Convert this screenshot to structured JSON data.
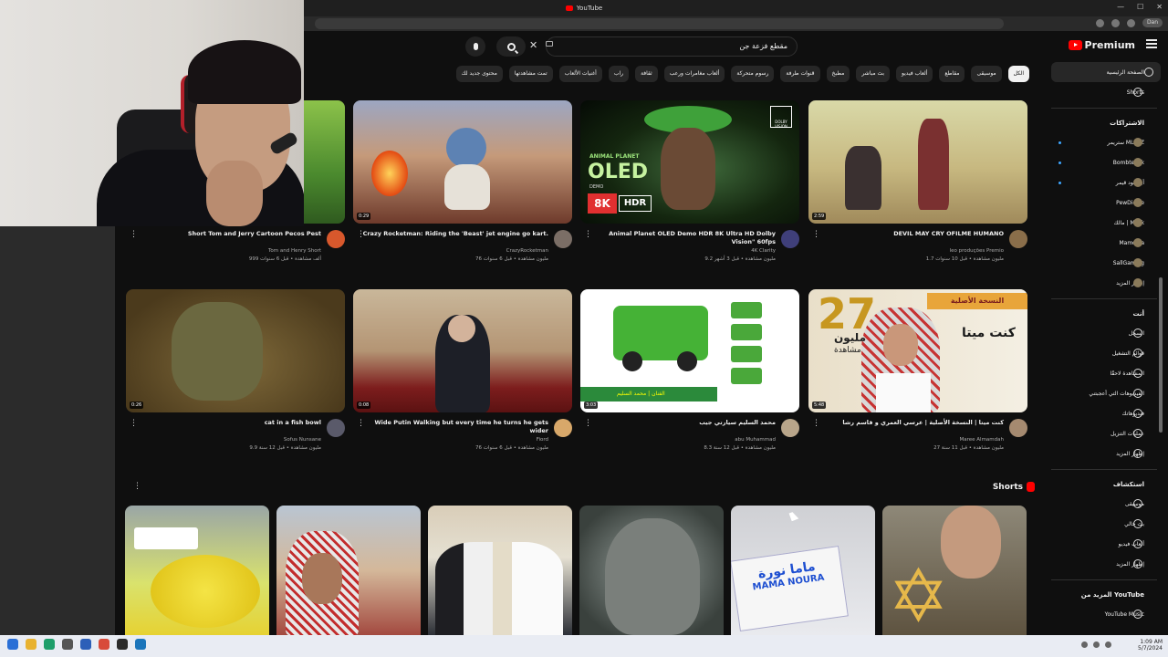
{
  "browser": {
    "tab_title": "YouTube",
    "user_chip": "Dan"
  },
  "masthead": {
    "logo_text": "Premium",
    "search_value": "مقطع فزعة جن",
    "icons": [
      "menu-icon",
      "search-icon",
      "mic-icon",
      "close-icon",
      "keyboard-icon"
    ]
  },
  "chips": [
    {
      "label": "الكل",
      "active": true
    },
    {
      "label": "موسيقى"
    },
    {
      "label": "مقاطع"
    },
    {
      "label": "ألعاب فيديو"
    },
    {
      "label": "بث مباشر"
    },
    {
      "label": "مطبخ"
    },
    {
      "label": "قنوات طرفة"
    },
    {
      "label": "رسوم متحركة"
    },
    {
      "label": "ألعاب مغامرات ورعب"
    },
    {
      "label": "ثقافة"
    },
    {
      "label": "راب"
    },
    {
      "label": "أغنيات الألعاب"
    },
    {
      "label": "تمت مشاهدتها"
    },
    {
      "label": "محتوى جديد لك"
    }
  ],
  "sidebar": {
    "main": [
      {
        "label": "الصفحة الرئيسية",
        "icon": "home-icon",
        "active": true
      },
      {
        "label": "Shorts",
        "icon": "shorts-icon"
      }
    ],
    "subscriptions_header": "الاشتراكات",
    "subscriptions": [
      {
        "label": "ستريمر MLZLZ",
        "live": true
      },
      {
        "label": "Bombtehkk",
        "live": true
      },
      {
        "label": "أبو جود قيمر",
        "live": true
      },
      {
        "label": "PewDiePie"
      },
      {
        "label": "مالك | Malik"
      },
      {
        "label": "Mamonia"
      },
      {
        "label": "SallGaming"
      },
      {
        "label": "إظهار المزيد"
      }
    ],
    "you_header": "أنت",
    "you": [
      {
        "label": "السجل",
        "icon": "history-icon"
      },
      {
        "label": "قوائم التشغيل",
        "icon": "playlist-icon"
      },
      {
        "label": "المشاهدة لاحقًا",
        "icon": "clock-icon"
      },
      {
        "label": "الفيديوهات التي أعجبتني",
        "icon": "thumbs-up-icon"
      },
      {
        "label": "فيديوهاتك",
        "icon": "video-icon"
      },
      {
        "label": "عمليات التنزيل",
        "icon": "download-icon"
      },
      {
        "label": "إظهار المزيد",
        "icon": "chevron-down-icon"
      }
    ],
    "explore_header": "استكشاف",
    "explore": [
      {
        "label": "موسيقى",
        "icon": "music-icon"
      },
      {
        "label": "بث حالي",
        "icon": "live-icon"
      },
      {
        "label": "ألعاب فيديو",
        "icon": "gaming-icon"
      },
      {
        "label": "إظهار المزيد",
        "icon": "chevron-down-icon"
      }
    ],
    "more_header": "المزيد من YouTube",
    "more": [
      {
        "label": "YouTube Music",
        "icon": "youtube-music-icon"
      }
    ]
  },
  "videos": [
    {
      "title": "DEVIL MAY CRY OFILME HUMANO",
      "channel": "leo produções Premio",
      "stats": "1.7 مليون مشاهدة • قبل 10 سنوات",
      "duration": "2:59",
      "avatar_color": "#8a6e4a",
      "thumb": "dmc"
    },
    {
      "title": "Animal Planet OLED Demo HDR 8K Ultra HD Dolby Vision\" 60fps",
      "channel": "4K Clarity",
      "stats": "9.2 مليون مشاهدة • قبل 3 أشهر",
      "duration": "",
      "avatar_color": "#3f3f7a",
      "thumb": "oled"
    },
    {
      "title": "Crazy Rocketman: Riding the 'Beast' jet engine go kart.",
      "channel": "CrazyRocketman",
      "stats": "76 مليون مشاهدة • قبل 6 سنوات",
      "duration": "0:29",
      "avatar_color": "#7b6e66",
      "thumb": "rocket"
    },
    {
      "title": "Short Tom and Jerry Cartoon Pecos Pest",
      "channel": "Tom and Henry Short",
      "stats": "999 ألف مشاهدة • قبل 6 سنوات",
      "duration": "",
      "avatar_color": "#d8582c",
      "thumb": "tom"
    },
    {
      "title": "كنت ميتا | النسخة الأصلية | عرسي العمري و قاسم رشا",
      "channel": "Maree Almamdah",
      "stats": "27 مليون مشاهدة • قبل 11 سنة",
      "duration": "5:48",
      "avatar_color": "#a58a70",
      "thumb": "saud"
    },
    {
      "title": "محمد السليم سيارتي جيب",
      "channel": "abu Muhammad",
      "stats": "8.3 مليون مشاهدة • قبل 12 سنة",
      "duration": "3:03",
      "avatar_color": "#b8a58a",
      "thumb": "car"
    },
    {
      "title": "Wide Putin Walking but every time he turns he gets wider",
      "channel": "Fiord",
      "stats": "76 مليون مشاهدة • قبل 6 سنوات",
      "duration": "0:08",
      "avatar_color": "#d8a86a",
      "thumb": "putin"
    },
    {
      "title": "cat in a fish bowl",
      "channel": "Sofus Nunsane",
      "stats": "9.9 مليون مشاهدة • قبل 12 سنة",
      "duration": "0:26",
      "avatar_color": "#5a5a6a",
      "thumb": "bag"
    }
  ],
  "video_thumb_text": {
    "oled_line1": "ANIMAL PLANET",
    "oled_line2": "OLED",
    "oled_line3": "DEMO",
    "oled_8k": "8K",
    "oled_hdr": "HDR",
    "oled_dolby": "DOLBY VISION",
    "saud_27": "27",
    "saud_million": "مليون",
    "saud_views": "مشاهدة",
    "saud_kunt": "كنت ميتا",
    "saud_band": "النسخة الأصلية",
    "car_band": "الفنان | محمد السليم"
  },
  "shorts": {
    "title": "Shorts",
    "mama_noura_ar": "ماما نورة",
    "mama_noura_en": "MAMA NOURA"
  },
  "taskbar": {
    "time": "1:09 AM",
    "date": "5/7/2024"
  }
}
